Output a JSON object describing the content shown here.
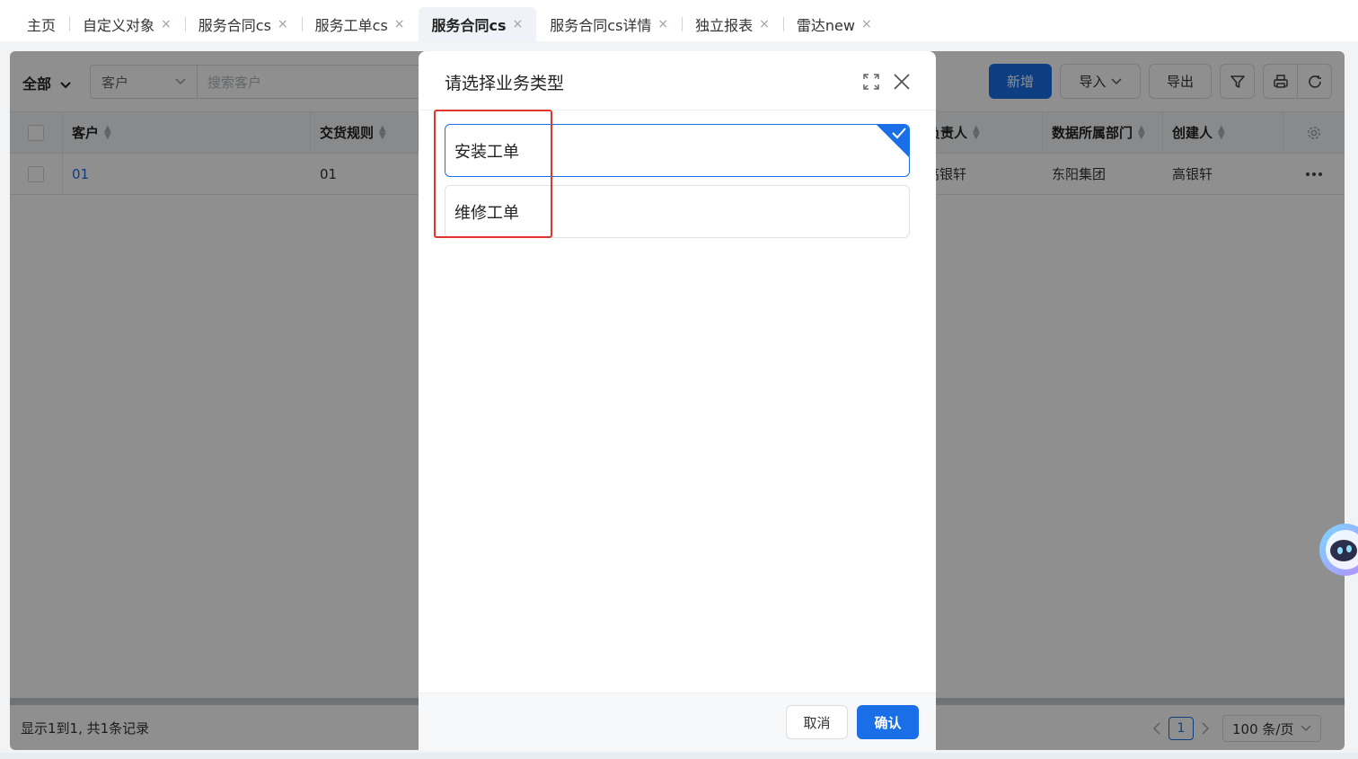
{
  "tabs": [
    {
      "label": "主页",
      "closable": false
    },
    {
      "label": "自定义对象",
      "closable": true
    },
    {
      "label": "服务合同cs",
      "closable": true
    },
    {
      "label": "服务工单cs",
      "closable": true
    },
    {
      "label": "服务合同cs",
      "closable": true,
      "active": true
    },
    {
      "label": "服务合同cs详情",
      "closable": true
    },
    {
      "label": "独立报表",
      "closable": true
    },
    {
      "label": "雷达new",
      "closable": true
    }
  ],
  "tab_close_glyph": "×",
  "toolbar": {
    "scope_label": "全部",
    "field_select": "客户",
    "search_placeholder": "搜索客户",
    "new_button": "新增",
    "import_button": "导入",
    "export_button": "导出"
  },
  "table": {
    "columns": [
      "客户",
      "交货规则",
      "负责人",
      "数据所属部门",
      "创建人"
    ],
    "rows": [
      {
        "customer": "01",
        "delivery_rule": "01",
        "owner": "高银轩",
        "department": "东阳集团",
        "creator": "高银轩"
      }
    ],
    "visible_owner_header_fragment": "负责人",
    "visible_owner_cell_fragment": "高银轩"
  },
  "footer": {
    "records_text": "显示1到1, 共1条记录",
    "current_page": "1",
    "page_size": "100 条/页"
  },
  "modal": {
    "title": "请选择业务类型",
    "options": [
      {
        "label": "安装工单",
        "selected": true
      },
      {
        "label": "维修工单",
        "selected": false
      }
    ],
    "cancel_label": "取消",
    "confirm_label": "确认"
  },
  "colors": {
    "primary": "#1a6fe8",
    "highlight_box": "#e0362c",
    "overlay": "rgba(0,0,0,0.44)"
  },
  "icons": [
    "chevron-down-icon",
    "filter-icon",
    "print-icon",
    "refresh-icon",
    "settings-icon",
    "more-icon",
    "expand-icon",
    "close-icon",
    "check-icon",
    "assistant-icon"
  ]
}
